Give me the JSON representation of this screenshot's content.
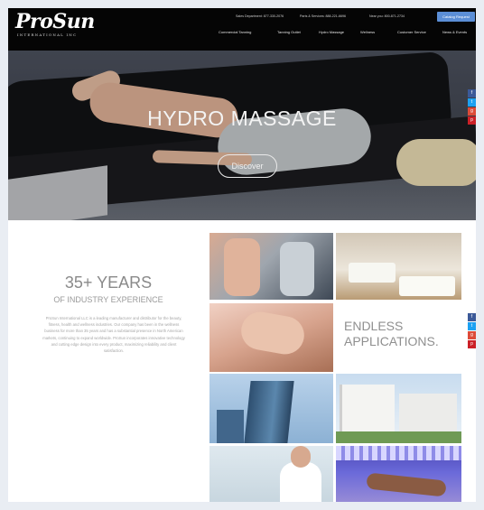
{
  "colors": {
    "header_bg": "#050505",
    "cta_bg": "#5b8ed6",
    "facebook": "#3b5998",
    "twitter": "#1da1f2",
    "googleplus": "#dd4b39",
    "pinterest": "#cb2027"
  },
  "header": {
    "logo": "ProSun",
    "logo_sub": "INTERNATIONAL INC",
    "contact": {
      "sales": "Sales Department: 877-330-2076",
      "parts": "Parts & Services: 888-221-6696",
      "east": "Near you: 800-871-2734"
    },
    "cta": "Catalog Request",
    "nav": [
      "Commercial Tanning",
      "Tanning Outlet",
      "Hydro Massage",
      "Wellness",
      "Customer Service",
      "News & Events"
    ]
  },
  "hero": {
    "title": "HYDRO MASSAGE",
    "button": "Discover"
  },
  "about": {
    "years": "35+ YEARS",
    "subtitle": "OF INDUSTRY EXPERIENCE",
    "text": "ProSun International LLC is a leading manufacturer and distributor for the beauty, fitness, health and wellness industries. Our company has been in the wellness business for more than 35 years and has a substantial presence in North American markets, continuing to expand worldwide. ProSun incorporates innovative technology and cutting edge design into every product, maximizing reliability and client satisfaction."
  },
  "endless": {
    "line1": "ENDLESS",
    "line2": "APPLICATIONS."
  },
  "social": [
    {
      "icon": "facebook-icon",
      "glyph": "f"
    },
    {
      "icon": "twitter-icon",
      "glyph": "t"
    },
    {
      "icon": "googleplus-icon",
      "glyph": "g"
    },
    {
      "icon": "pinterest-icon",
      "glyph": "p"
    }
  ]
}
